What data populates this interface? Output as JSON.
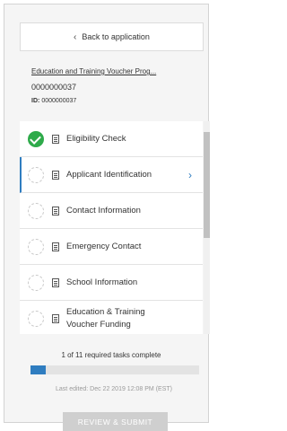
{
  "nav": {
    "back_label": "Back to application"
  },
  "application": {
    "title": "Education and Training Voucher Prog...",
    "number": "0000000037",
    "id_label": "ID:",
    "id_value": "0000000037"
  },
  "tasks": [
    {
      "label": "Eligibility Check",
      "status": "complete"
    },
    {
      "label": "Applicant Identification",
      "status": "incomplete",
      "active": true
    },
    {
      "label": "Contact Information",
      "status": "incomplete"
    },
    {
      "label": "Emergency Contact",
      "status": "incomplete"
    },
    {
      "label": "School Information",
      "status": "incomplete"
    },
    {
      "label": "Education & Training Voucher Funding",
      "status": "incomplete"
    }
  ],
  "progress": {
    "text": "1 of 11 required tasks complete",
    "completed": 1,
    "total": 11
  },
  "last_edited": "Last edited: Dec 22 2019 12:08 PM (EST)",
  "submit_label": "REVIEW & SUBMIT",
  "colors": {
    "accent": "#2f7dc0",
    "complete": "#2eaa4a",
    "submit_disabled": "#cfcfcf"
  },
  "icons": {
    "back": "chevron-left-icon",
    "complete": "check-circle-icon",
    "incomplete": "dashed-circle-icon",
    "task": "document-icon",
    "open": "chevron-right-icon"
  }
}
